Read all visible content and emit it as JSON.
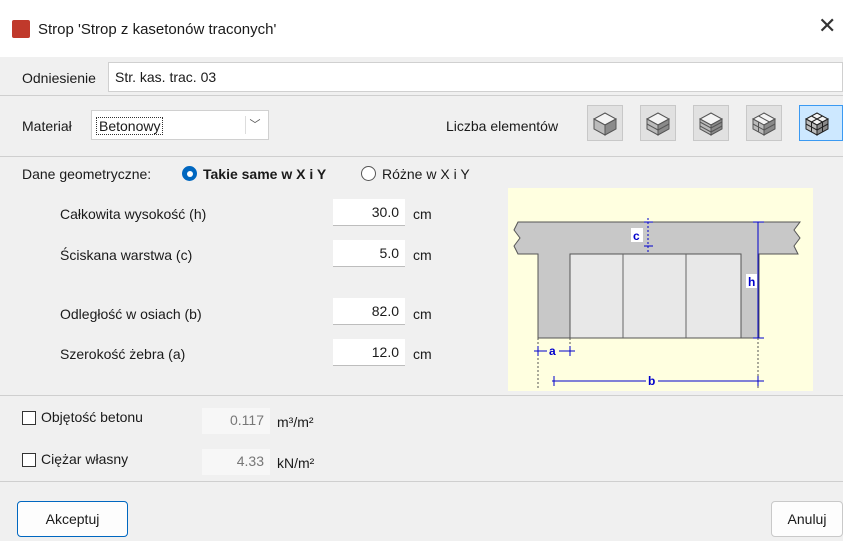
{
  "window": {
    "title": "Strop 'Strop z kasetonów traconych'",
    "close_glyph": "✕"
  },
  "reference": {
    "label": "Odniesienie",
    "value": "Str. kas. trac. 03"
  },
  "material": {
    "label": "Materiał",
    "selected": "Betonowy"
  },
  "elements": {
    "label": "Liczba elementów",
    "selected_index": 4
  },
  "geometry": {
    "label": "Dane geometryczne:",
    "option_same": "Takie same w X i Y",
    "option_diff": "Różne w X i Y",
    "fields": [
      {
        "label": "Całkowita wysokość (h)",
        "value": "30.0",
        "unit": "cm"
      },
      {
        "label": "Ściskana warstwa (c)",
        "value": "5.0",
        "unit": "cm"
      },
      {
        "label": "Odległość w osiach (b)",
        "value": "82.0",
        "unit": "cm"
      },
      {
        "label": "Szerokość żebra (a)",
        "value": "12.0",
        "unit": "cm"
      }
    ],
    "diagram": {
      "c": "c",
      "h": "h",
      "a": "a",
      "b": "b"
    }
  },
  "results": {
    "volume": {
      "label": "Objętość betonu",
      "value": "0.117",
      "unit": "m³/m²"
    },
    "weight": {
      "label": "Ciężar własny",
      "value": "4.33",
      "unit": "kN/m²"
    }
  },
  "buttons": {
    "accept": "Akceptuj",
    "cancel": "Anuluj"
  },
  "colors": {
    "accent": "#0067c0",
    "diagram_bg": "#ffffe0",
    "dim_blue": "#0000cc"
  }
}
